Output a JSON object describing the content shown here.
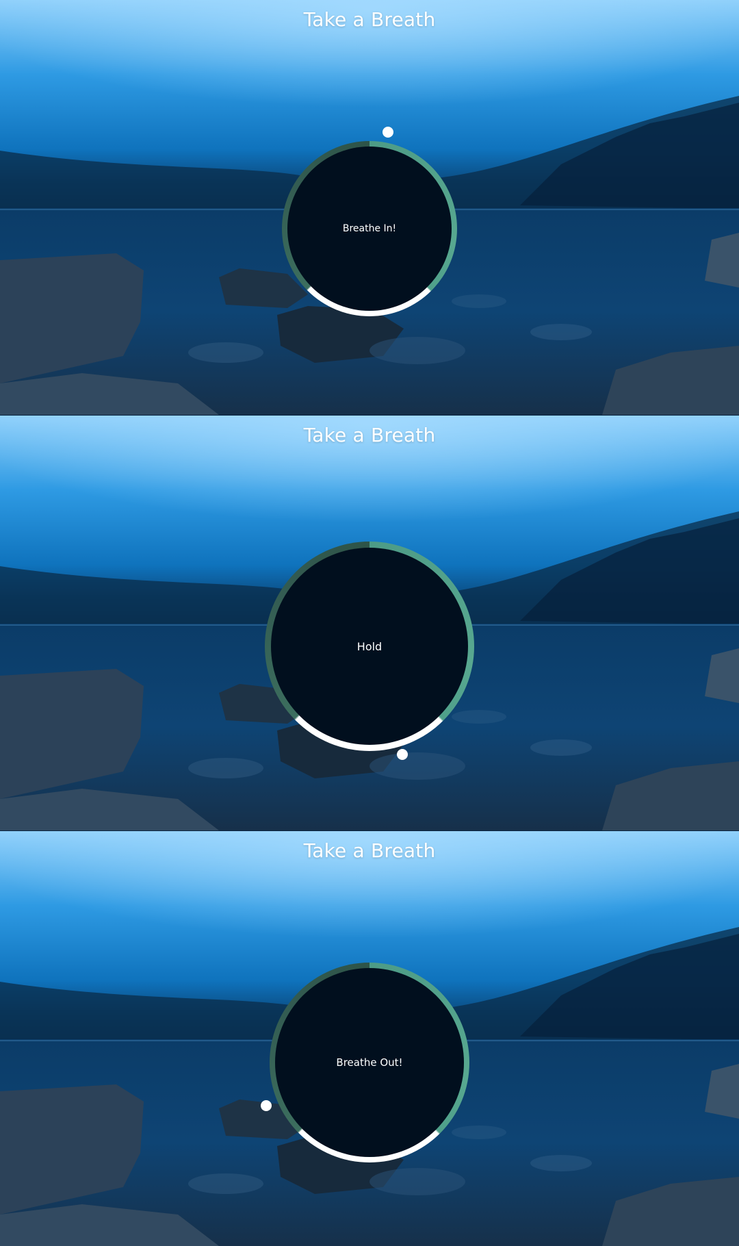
{
  "app": {
    "title": "Take a Breath"
  },
  "frames": [
    {
      "state": "Breathe In!",
      "pointer_angle_deg": 8
    },
    {
      "state": "Hold",
      "pointer_angle_deg": 162
    },
    {
      "state": "Breathe Out!",
      "pointer_angle_deg": 252
    }
  ],
  "colors": {
    "ring_light": "#58a890",
    "ring_dark": "#335c52",
    "ring_highlight": "#ffffff",
    "core": "#010f1e",
    "sky_top": "#7fc7f4",
    "water": "#0d3d66"
  },
  "icons": {
    "pointer": "pointer-dot-icon"
  }
}
